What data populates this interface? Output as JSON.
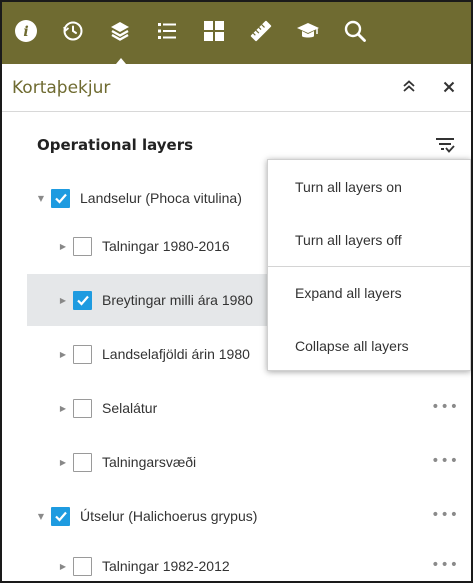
{
  "toolbar": {
    "icons": [
      "info-icon",
      "history-icon",
      "layers-icon",
      "legend-icon",
      "basemap-gallery-icon",
      "measurement-icon",
      "education-icon",
      "search-icon"
    ],
    "active": "layers-icon",
    "background": "#6f6b31"
  },
  "panel": {
    "title": "Kortaþekjur",
    "collapse_icon": "double-chevron-up-icon",
    "close_icon": "close-icon"
  },
  "section": {
    "title": "Operational layers"
  },
  "layers": [
    {
      "label": "Landselur (Phoca vitulina)",
      "checked": true,
      "expanded": true
    },
    {
      "label": "Talningar 1980-2016",
      "checked": false,
      "expanded": false
    },
    {
      "label": "Breytingar milli ára 1980",
      "checked": true,
      "expanded": false,
      "selected": true
    },
    {
      "label": "Landselafjöldi árin 1980",
      "checked": false,
      "expanded": false
    },
    {
      "label": "Selalátur",
      "checked": false,
      "expanded": false
    },
    {
      "label": "Talningarsvæði",
      "checked": false,
      "expanded": false
    },
    {
      "label": "Útselur (Halichoerus grypus)",
      "checked": true,
      "expanded": true
    },
    {
      "label": "Talningar 1982-2012",
      "checked": false,
      "expanded": false
    }
  ],
  "menu": {
    "items": [
      "Turn all layers on",
      "Turn all layers off",
      "Expand all layers",
      "Collapse all layers"
    ]
  },
  "colors": {
    "accent": "#6f6b31",
    "checkbox": "#1e9be0",
    "selected_row": "#e5e7e9"
  }
}
